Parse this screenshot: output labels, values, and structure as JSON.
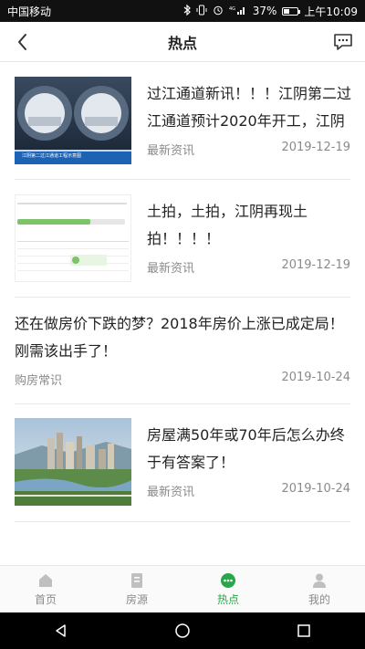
{
  "status": {
    "carrier": "中国移动",
    "battery": "37%",
    "battery_level": 0.37,
    "time": "上午10:09"
  },
  "header": {
    "title": "热点"
  },
  "articles": [
    {
      "title_line1": "过江通道新讯！！！江阴第二过",
      "title_line2": "江通道预计2020年开工，江阴",
      "category": "最新资讯",
      "date": "2019-12-19",
      "thumb_caption": "江阴第二过江通道工程示意图"
    },
    {
      "title_line1": "土拍，土拍，江阴再现土",
      "title_line2": "拍！！！！",
      "category": "最新资讯",
      "date": "2019-12-19"
    },
    {
      "title_line1": "还在做房价下跌的梦？2018年房价上涨已成定局！",
      "title_line2": "刚需该出手了！",
      "category": "购房常识",
      "date": "2019-10-24"
    },
    {
      "title_line1": "房屋满50年或70年后怎么办终",
      "title_line2": "于有答案了！",
      "category": "最新资讯",
      "date": "2019-10-24"
    }
  ],
  "tabs": [
    {
      "label": "首页"
    },
    {
      "label": "房源"
    },
    {
      "label": "热点"
    },
    {
      "label": "我的"
    }
  ],
  "colors": {
    "accent": "#27a74a",
    "inactive": "#8a8a8a"
  }
}
